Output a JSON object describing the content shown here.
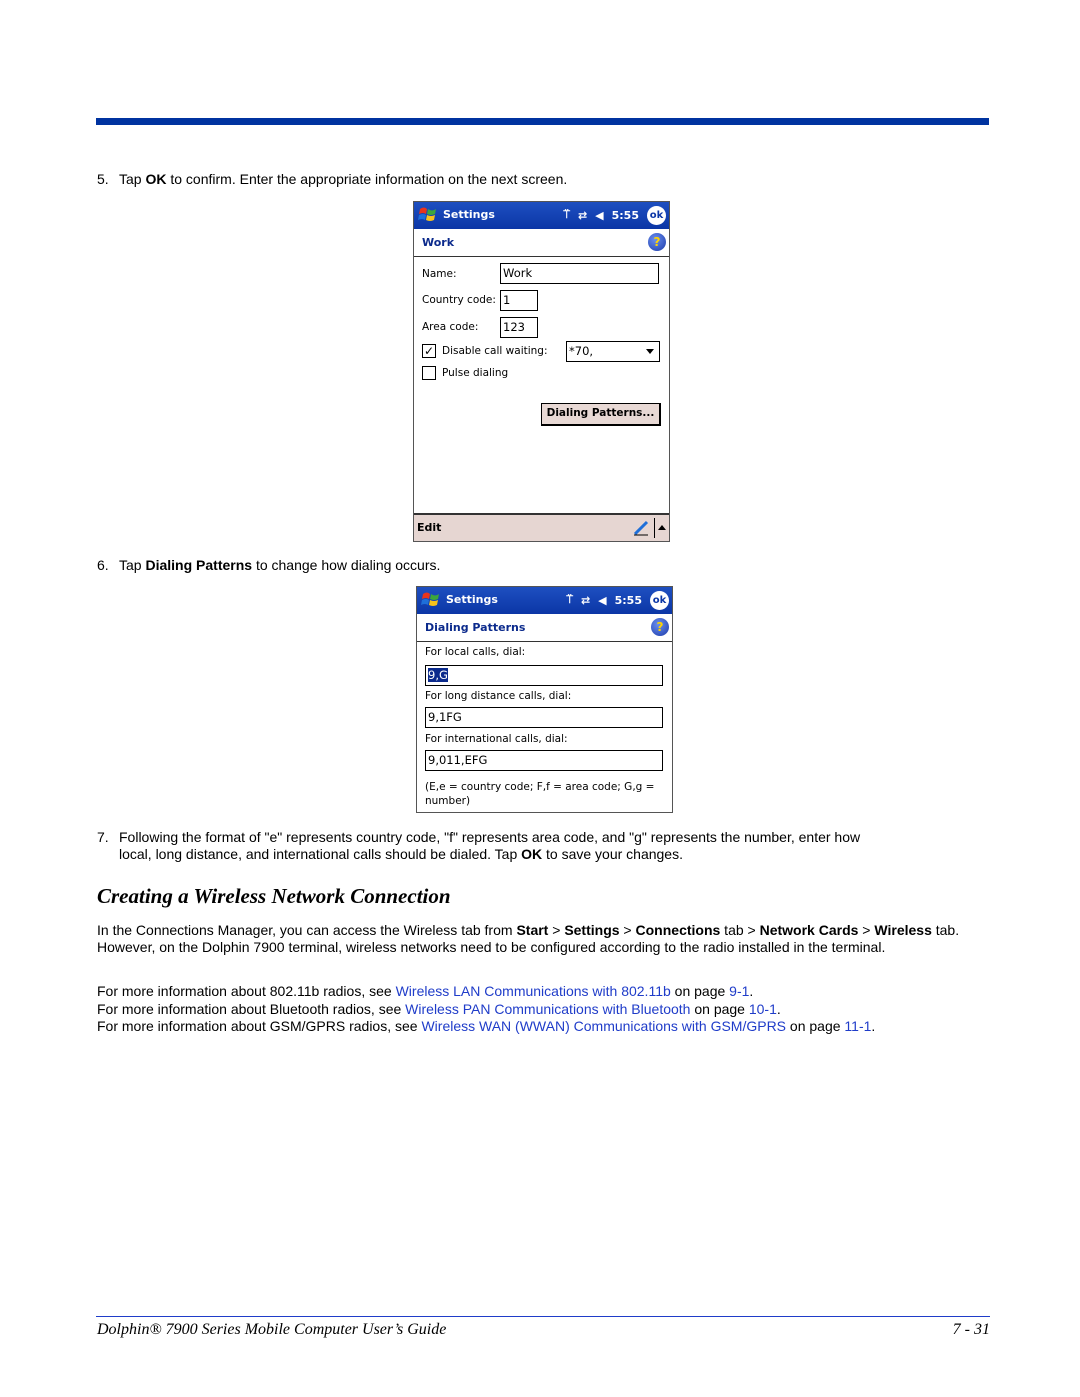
{
  "step5": {
    "num": "5.",
    "pre": "Tap ",
    "bold": "OK",
    "post": " to confirm. Enter the appropriate information on the next screen."
  },
  "screen1": {
    "app_title": "Settings",
    "time": "5:55",
    "ok_label": "ok",
    "subheader": "Work",
    "help_label": "?",
    "name_label": "Name:",
    "name_value": "Work",
    "country_label": "Country code:",
    "country_value": "1",
    "area_label": "Area code:",
    "area_value": "123",
    "disable_cw_label": "Disable call waiting:",
    "disable_cw_checked": true,
    "disable_cw_value": "*70,",
    "pulse_label": "Pulse dialing",
    "pulse_checked": false,
    "dialing_patterns_button": "Dialing Patterns...",
    "menu_edit": "Edit"
  },
  "step6": {
    "num": "6.",
    "pre": "Tap ",
    "bold": "Dialing Patterns",
    "post": " to change how dialing occurs."
  },
  "screen2": {
    "app_title": "Settings",
    "time": "5:55",
    "ok_label": "ok",
    "subheader": "Dialing Patterns",
    "help_label": "?",
    "local_label": "For local calls, dial:",
    "local_value": "9,G",
    "long_label": "For long distance calls, dial:",
    "long_value": "9,1FG",
    "intl_label": "For international calls, dial:",
    "intl_value": "9,011,EFG",
    "note_line1": "(E,e = country code; F,f = area code; G,g =",
    "note_line2": "number)"
  },
  "step7": {
    "num": "7.",
    "line1": "Following the format of \"e\" represents country code, \"f\" represents area code, and \"g\" represents the number, enter how",
    "line2_pre": "local, long distance, and international calls should be dialed. Tap ",
    "line2_bold": "OK",
    "line2_post": " to save your changes."
  },
  "section_heading": "Creating a Wireless Network Connection",
  "intro": {
    "t1": "In the Connections Manager, you can access the Wireless tab from ",
    "b1": "Start",
    "t2": " > ",
    "b2": "Settings",
    "t3": " > ",
    "b3": "Connections",
    "t4": " tab > ",
    "b4": "Network Cards",
    "t5": " > ",
    "b5": "Wireless",
    "t6": " tab. However, on the Dolphin 7900 terminal, wireless networks need to be configured according to the radio installed in the terminal."
  },
  "refs": [
    {
      "pre": "For more information about 802.11b radios, see ",
      "link": "Wireless LAN Communications with 802.11b",
      "mid": " on page ",
      "page": "9-1",
      "post": "."
    },
    {
      "pre": "For more information about Bluetooth radios, see ",
      "link": "Wireless PAN Communications with Bluetooth",
      "mid": " on page ",
      "page": "10-1",
      "post": "."
    },
    {
      "pre": "For more information about GSM/GPRS radios, see ",
      "link": "Wireless WAN (WWAN) Communications with GSM/GPRS",
      "mid": " on page ",
      "page": "11-1",
      "post": "."
    }
  ],
  "footer": {
    "title": "Dolphin® 7900 Series Mobile Computer User’s Guide",
    "page": "7 - 31"
  },
  "colors": {
    "accent_blue": "#0033a0",
    "link_blue": "#1f3cc9",
    "menubar": "#e6d6d2"
  }
}
